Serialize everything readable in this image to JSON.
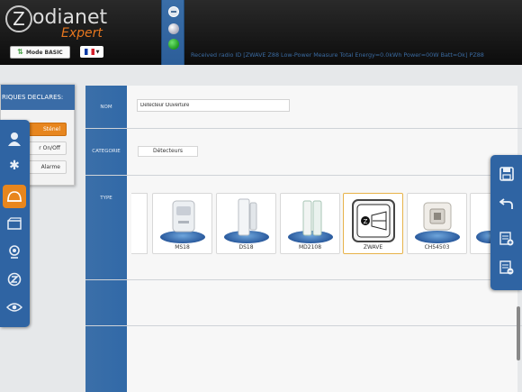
{
  "header": {
    "logo_initial": "Z",
    "logo_text": "odianet",
    "logo_sub": "Expert",
    "mode_button": "Mode BASIC",
    "status_text": "Received radio ID [ZWAVE Z88 Low-Power Measure Total Energy=0.0kWh Power=00W Batt=Ok] PZ88"
  },
  "left_panel": {
    "title": "RIQUES DECLARES:",
    "buttons": [
      "Sténel",
      "r On/Off",
      "Alarme"
    ]
  },
  "left_nav": [
    "user-icon",
    "settings-gears-icon",
    "alarm-bell-icon",
    "scenario-film-icon",
    "camera-icon",
    "zodianet-icon",
    "eye-icon"
  ],
  "form": {
    "rows": [
      "NOM",
      "CATEGORIE",
      "TYPE"
    ],
    "name_value": "Detecteur Ouverture",
    "category_value": "Détecteurs",
    "types": [
      "MS18",
      "DS18",
      "MD2108",
      "ZWAVE",
      "CH54503"
    ],
    "selected_type": "ZWAVE"
  },
  "right_toolbar": [
    "save-icon",
    "undo-icon",
    "add-list-icon",
    "remove-list-icon"
  ],
  "colors": {
    "brand_blue": "#3169a7",
    "accent_orange": "#e8861d",
    "logo_orange": "#e6761e"
  }
}
